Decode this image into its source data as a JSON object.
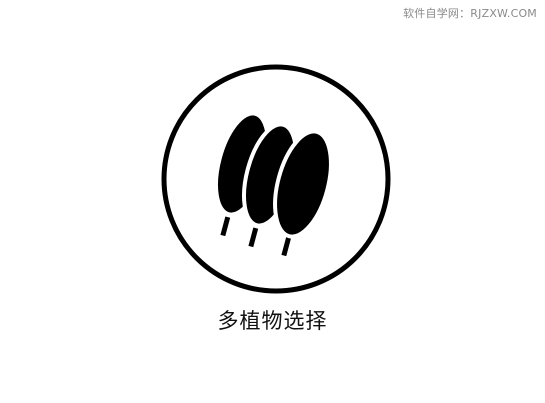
{
  "watermark": {
    "text": "软件自学网：RJZXW.COM"
  },
  "icon": {
    "name": "multi-plant-select-icon",
    "stroke_color": "#000000",
    "fill_color": "#000000",
    "leaf_count": 3
  },
  "caption": {
    "text": "多植物选择"
  },
  "colors": {
    "background": "#ffffff",
    "foreground": "#000000",
    "watermark": "#8a8a8a"
  }
}
